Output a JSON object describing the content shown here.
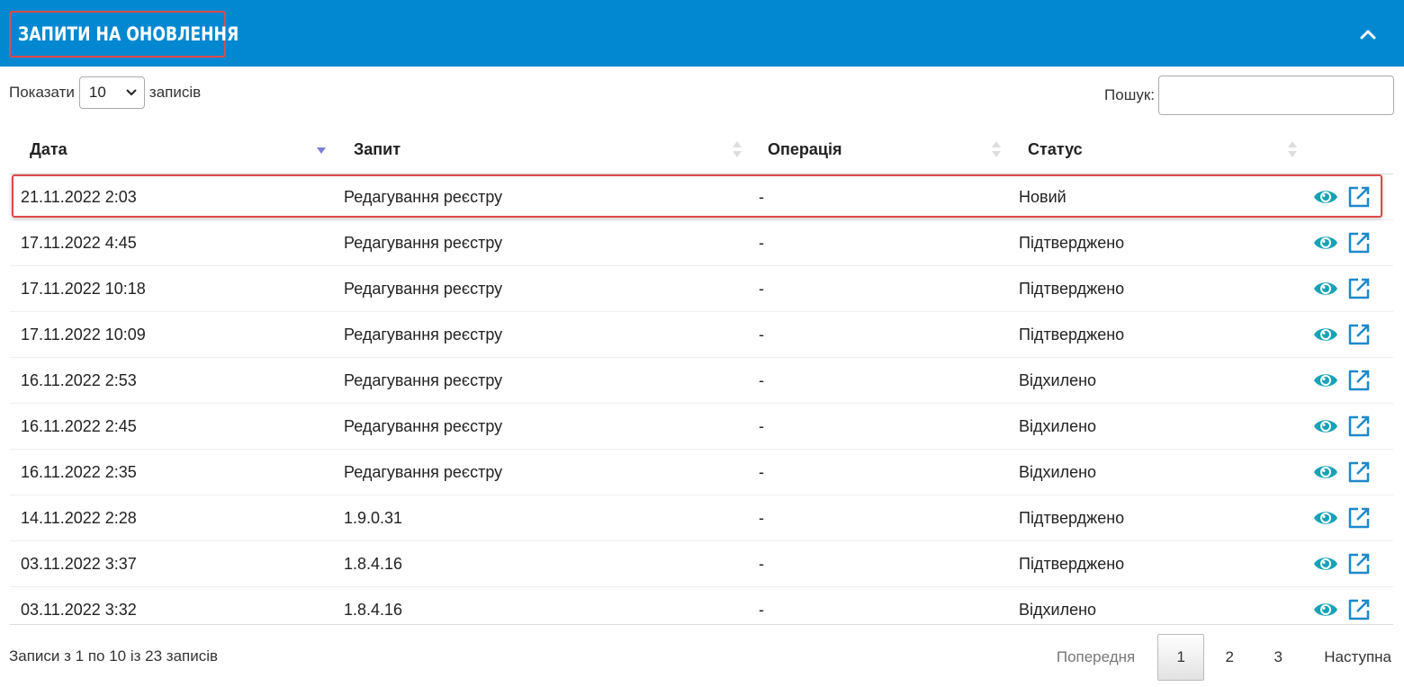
{
  "header": {
    "title": "ЗАПИТИ НА ОНОВЛЕННЯ",
    "color": "#0288d1",
    "collapse_icon": "chevron-up-icon"
  },
  "controls": {
    "show_label": "Показати",
    "page_size": "10",
    "entries_label": "записів",
    "search_label": "Пошук:",
    "search_value": ""
  },
  "table": {
    "columns": [
      "Дата",
      "Запит",
      "Операція",
      "Статус"
    ],
    "sort_column": "Дата",
    "rows": [
      {
        "date": "21.11.2022 2:03",
        "request": "Редагування реєстру",
        "operation": "-",
        "status": "Новий"
      },
      {
        "date": "17.11.2022 4:45",
        "request": "Редагування реєстру",
        "operation": "-",
        "status": "Підтверджено"
      },
      {
        "date": "17.11.2022 10:18",
        "request": "Редагування реєстру",
        "operation": "-",
        "status": "Підтверджено"
      },
      {
        "date": "17.11.2022 10:09",
        "request": "Редагування реєстру",
        "operation": "-",
        "status": "Підтверджено"
      },
      {
        "date": "16.11.2022 2:53",
        "request": "Редагування реєстру",
        "operation": "-",
        "status": "Відхилено"
      },
      {
        "date": "16.11.2022 2:45",
        "request": "Редагування реєстру",
        "operation": "-",
        "status": "Відхилено"
      },
      {
        "date": "16.11.2022 2:35",
        "request": "Редагування реєстру",
        "operation": "-",
        "status": "Відхилено"
      },
      {
        "date": "14.11.2022 2:28",
        "request": "1.9.0.31",
        "operation": "-",
        "status": "Підтверджено"
      },
      {
        "date": "03.11.2022 3:37",
        "request": "1.8.4.16",
        "operation": "-",
        "status": "Підтверджено"
      },
      {
        "date": "03.11.2022 3:32",
        "request": "1.8.4.16",
        "operation": "-",
        "status": "Відхилено"
      }
    ],
    "row_icons": [
      "eye-icon",
      "external-link-icon"
    ],
    "icon_colors": {
      "eye": "#17a2b8",
      "link": "#1e88c9"
    }
  },
  "footer": {
    "info": "Записи з 1 по 10 із 23 записів",
    "prev": "Попередня",
    "pages": [
      "1",
      "2",
      "3"
    ],
    "active_page": "1",
    "next": "Наступна"
  },
  "highlight_color": "#e0484a"
}
